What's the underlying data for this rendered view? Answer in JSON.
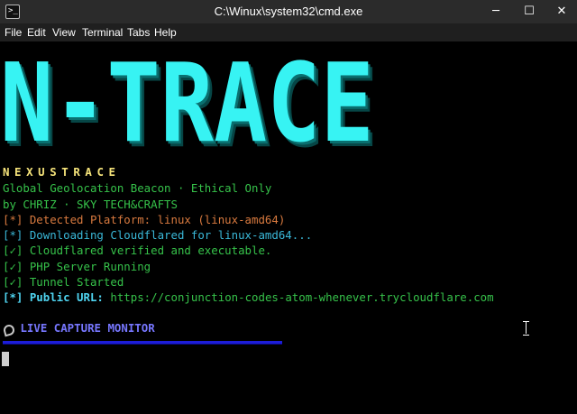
{
  "window": {
    "icon_glyph": ">_",
    "title": "C:\\Winux\\system32\\cmd.exe",
    "minimize_glyph": "─",
    "maximize_glyph": "☐",
    "close_glyph": "✕"
  },
  "menu": [
    "File",
    "Edit",
    "View",
    "Terminal",
    "Tabs",
    "Help"
  ],
  "terminal": {
    "logo_text": "N-TRACE",
    "brand": "NEXUSTRACE",
    "tagline": "Global Geolocation Beacon · Ethical Only",
    "credit": "by CHRIZ · SKY TECH&CRAFTS",
    "platform_line": "[*] Detected Platform: linux (linux-amd64)",
    "download_line": "[*] Downloading Cloudflared for linux-amd64...",
    "verified_line": "[✓] Cloudflared verified and executable.",
    "php_line": "[✓] PHP Server Running",
    "tunnel_line": "[✓] Tunnel Started",
    "url_label": "[*] Public URL:",
    "url_value": "https://conjunction-codes-atom-whenever.trycloudflare.com",
    "monitor_label": "LIVE CAPTURE MONITOR"
  },
  "colors": {
    "logo": "#37f3f3",
    "brand": "#f5e37a",
    "green": "#36c24a",
    "orange": "#d97a3f",
    "cyan": "#3ab8d8",
    "monitor": "#7777ff",
    "divider": "#1d1dd8"
  },
  "icons": {
    "monitor": "satellite-icon",
    "pointer": "text-cursor-icon"
  }
}
